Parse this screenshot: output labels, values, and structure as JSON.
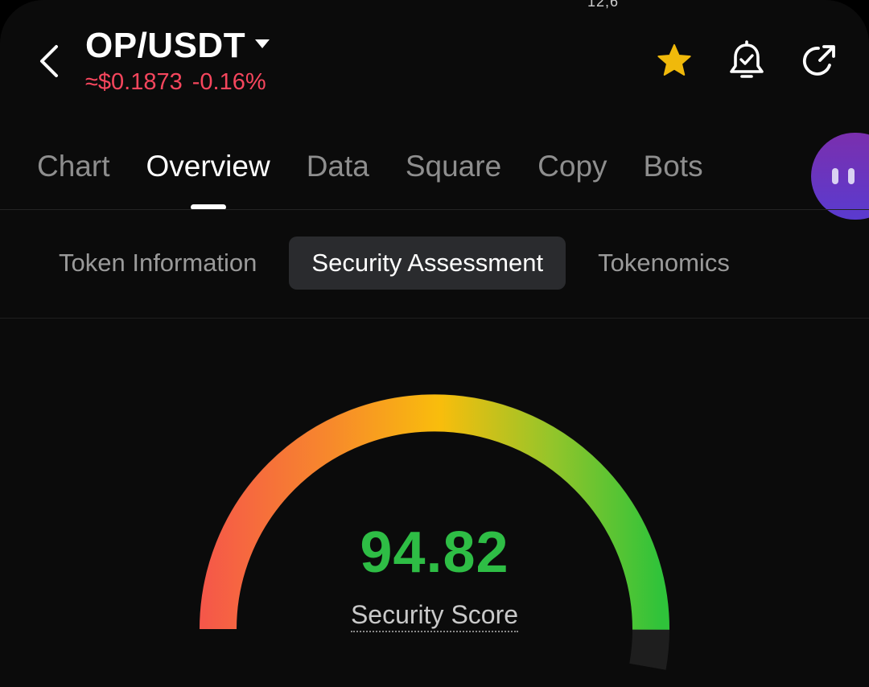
{
  "header": {
    "pair": "OP/USDT",
    "price": "≈$0.1873",
    "change": "-0.16%",
    "status_fragment": "12,6"
  },
  "colors": {
    "negative": "#f6465d",
    "positive": "#2ebd45",
    "favorite": "#f0b90b"
  },
  "icons": [
    "back-arrow-icon",
    "dropdown-caret-icon",
    "star-icon",
    "bell-check-icon",
    "share-icon"
  ],
  "main_tabs": [
    {
      "label": "Chart"
    },
    {
      "label": "Overview",
      "active": true
    },
    {
      "label": "Data"
    },
    {
      "label": "Square"
    },
    {
      "label": "Copy"
    },
    {
      "label": "Bots"
    }
  ],
  "sub_tabs": [
    {
      "label": "Token Information"
    },
    {
      "label": "Security Assessment",
      "active": true
    },
    {
      "label": "Tokenomics"
    }
  ],
  "security": {
    "score": "94.82",
    "score_max": 100,
    "label": "Security Score"
  }
}
